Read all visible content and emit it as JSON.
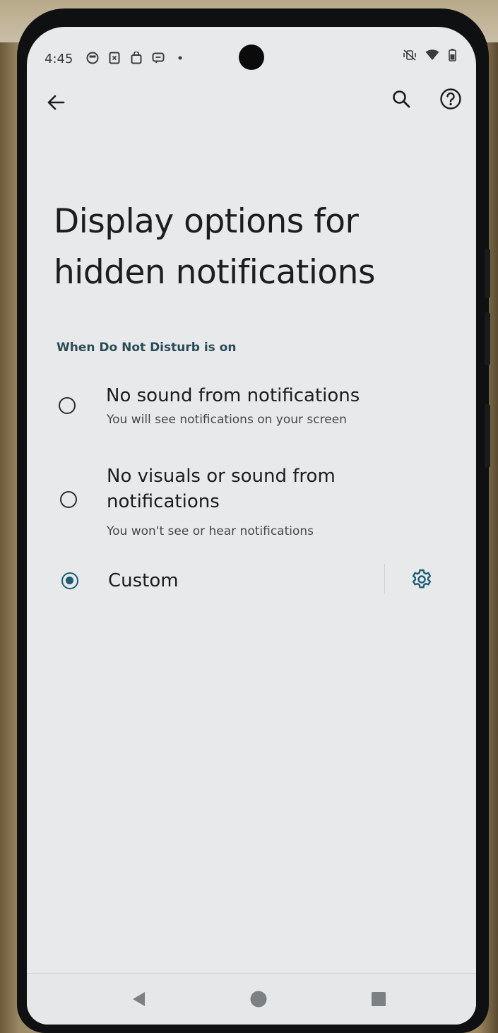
{
  "status_bar": {
    "time": "4:45",
    "left_icons": [
      "notification-app-icon",
      "sim-icon",
      "bag-icon",
      "message-icon",
      "dot-icon"
    ],
    "right_icons": [
      "vibrate-off-icon",
      "wifi-icon",
      "battery-icon"
    ]
  },
  "app_bar": {
    "back_icon": "arrow-left-icon",
    "search_icon": "search-icon",
    "help_icon": "help-icon"
  },
  "page": {
    "title_line1": "Display options for",
    "title_line2": "hidden notifications",
    "section_header": "When Do Not Disturb is on"
  },
  "options": [
    {
      "title": "No sound from notifications",
      "subtitle": "You will see notifications on your screen",
      "selected": false
    },
    {
      "title_line1": "No visuals or sound from",
      "title_line2": "notifications",
      "subtitle": "You won't see or hear notifications",
      "selected": false
    },
    {
      "title": "Custom",
      "selected": true,
      "settings_icon": "gear-icon"
    }
  ],
  "nav_bar": {
    "back": "triangle-back-icon",
    "home": "circle-home-icon",
    "recents": "square-recents-icon"
  },
  "colors": {
    "accent": "#1d5e74",
    "screen_bg": "#e7e9ea",
    "text_primary": "#1c1d1f",
    "section_header": "#2b4b58"
  }
}
